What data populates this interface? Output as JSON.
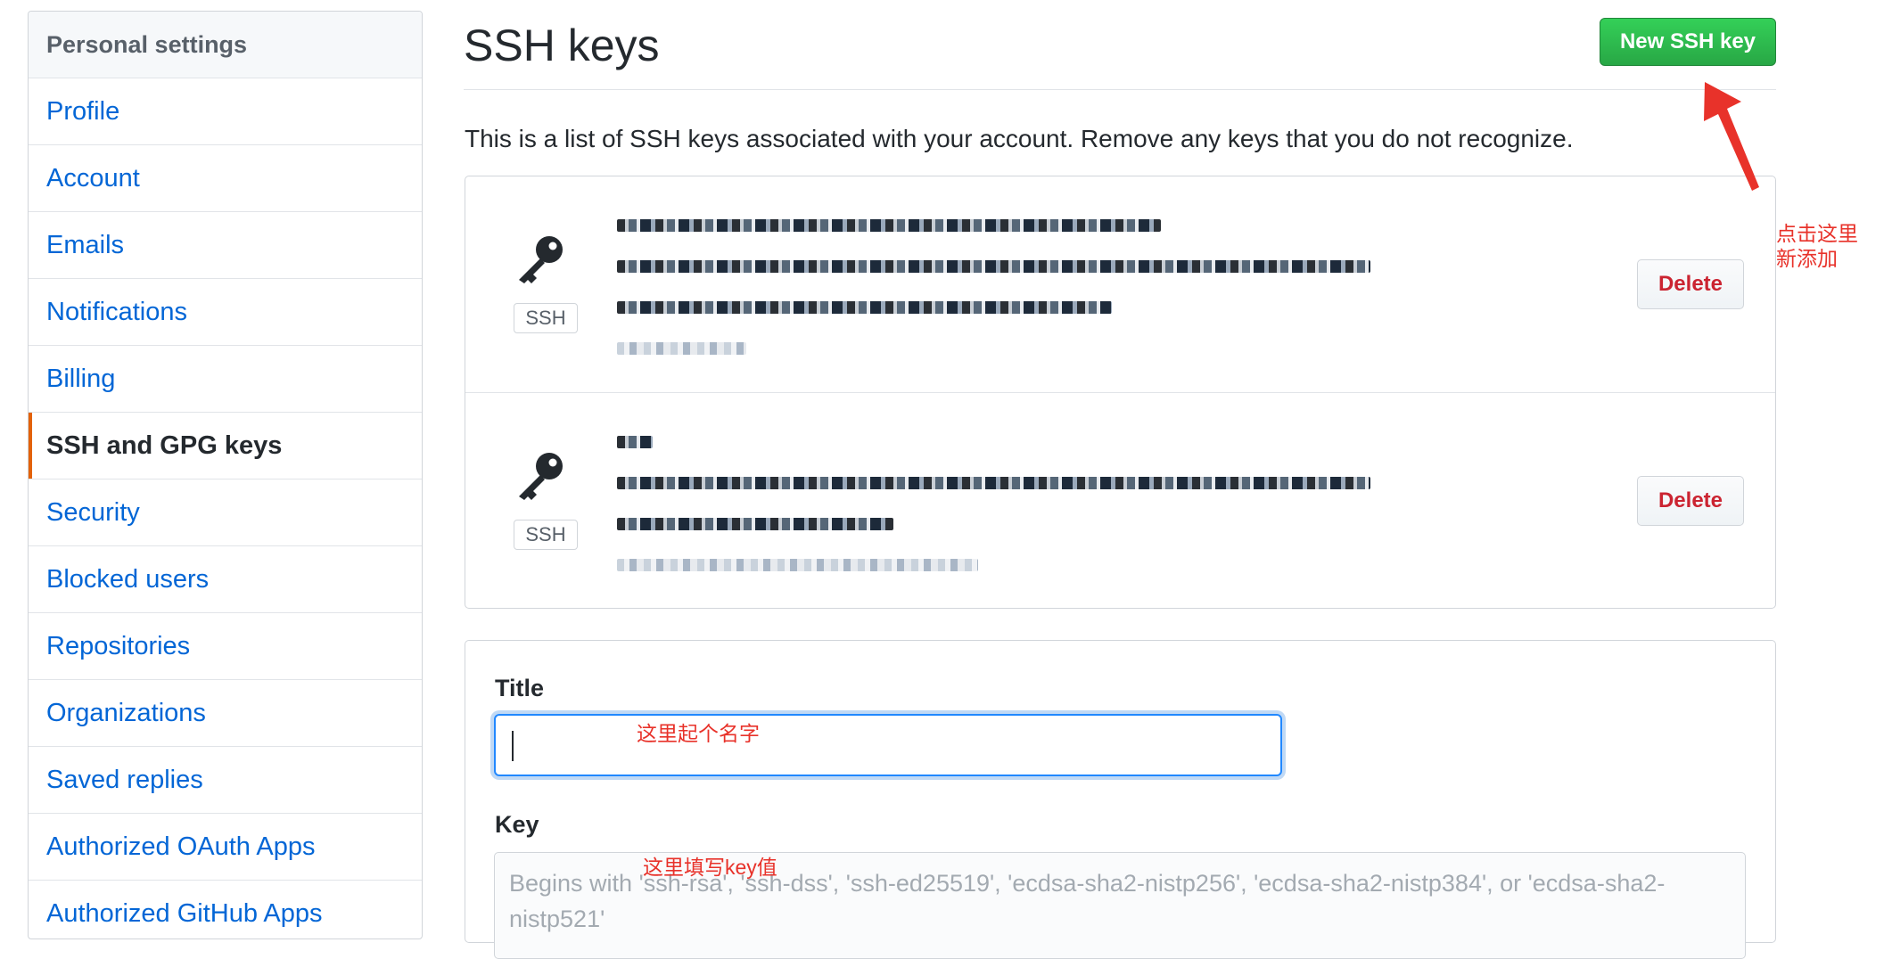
{
  "sidebar": {
    "header": "Personal settings",
    "items": [
      {
        "label": "Profile"
      },
      {
        "label": "Account"
      },
      {
        "label": "Emails"
      },
      {
        "label": "Notifications"
      },
      {
        "label": "Billing"
      },
      {
        "label": "SSH and GPG keys",
        "selected": true
      },
      {
        "label": "Security"
      },
      {
        "label": "Blocked users"
      },
      {
        "label": "Repositories"
      },
      {
        "label": "Organizations"
      },
      {
        "label": "Saved replies"
      },
      {
        "label": "Authorized OAuth Apps"
      },
      {
        "label": "Authorized GitHub Apps"
      }
    ]
  },
  "header": {
    "title": "SSH keys",
    "new_key_label": "New SSH key"
  },
  "intro": "This is a list of SSH keys associated with your account. Remove any keys that you do not recognize.",
  "keys": [
    {
      "tag": "SSH",
      "delete_label": "Delete"
    },
    {
      "tag": "SSH",
      "delete_label": "Delete"
    }
  ],
  "form": {
    "title_label": "Title",
    "title_value": "",
    "key_label": "Key",
    "key_placeholder": "Begins with 'ssh-rsa', 'ssh-dss', 'ssh-ed25519', 'ecdsa-sha2-nistp256', 'ecdsa-sha2-nistp384', or 'ecdsa-sha2-nistp521'"
  },
  "annotations": {
    "new_key_note_line1": "点击这里",
    "new_key_note_line2": "新添加",
    "title_note": "这里起个名字",
    "key_note": "这里填写key值"
  },
  "colors": {
    "link": "#0366d6",
    "selected_accent": "#e36209",
    "primary_button": "#28a745",
    "danger": "#cb2431",
    "annotation": "#e8322a",
    "focus": "#2188ff"
  }
}
